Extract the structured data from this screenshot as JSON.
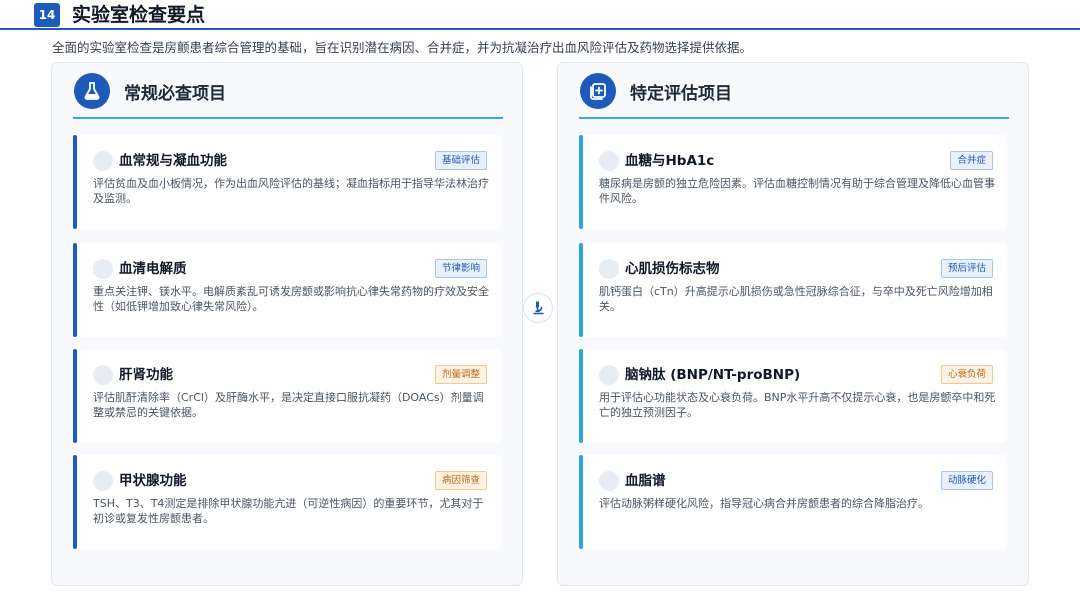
{
  "header": {
    "page_number": "14",
    "title": "实验室检查要点"
  },
  "intro": "全面的实验室检查是房颤患者综合管理的基础，旨在识别潜在病因、合并症，并为抗凝治疗出血风险评估及药物选择提供依据。",
  "icons": {
    "left_panel": "flask-icon",
    "right_panel": "medical-report-icon",
    "center": "microscope-icon",
    "card_marker": "circle-icon"
  },
  "colors": {
    "primary": "#1e5bb8",
    "accent": "#2aa8dc",
    "tag_blue": "#1e5bb8",
    "tag_orange": "#c06a12"
  },
  "left_panel": {
    "title": "常规必查项目",
    "cards": [
      {
        "title": "血常规与凝血功能",
        "tag": "基础评估",
        "tag_color": "blue",
        "desc": "评估贫血及血小板情况，作为出血风险评估的基线；凝血指标用于指导华法林治疗及监测。"
      },
      {
        "title": "血清电解质",
        "tag": "节律影响",
        "tag_color": "blue",
        "desc": "重点关注钾、镁水平。电解质紊乱可诱发房颤或影响抗心律失常药物的疗效及安全性（如低钾增加致心律失常风险）。"
      },
      {
        "title": "肝肾功能",
        "tag": "剂量调整",
        "tag_color": "orange",
        "desc": "评估肌酐清除率（CrCl）及肝酶水平，是决定直接口服抗凝药（DOACs）剂量调整或禁忌的关键依据。"
      },
      {
        "title": "甲状腺功能",
        "tag": "病因筛查",
        "tag_color": "orange",
        "desc": "TSH、T3、T4测定是排除甲状腺功能亢进（可逆性病因）的重要环节，尤其对于初诊或复发性房颤患者。"
      }
    ]
  },
  "right_panel": {
    "title": "特定评估项目",
    "cards": [
      {
        "title": "血糖与HbA1c",
        "tag": "合并症",
        "tag_color": "blue",
        "desc": "糖尿病是房颤的独立危险因素。评估血糖控制情况有助于综合管理及降低心血管事件风险。"
      },
      {
        "title": "心肌损伤标志物",
        "tag": "预后评估",
        "tag_color": "blue",
        "desc": "肌钙蛋白（cTn）升高提示心肌损伤或急性冠脉综合征，与卒中及死亡风险增加相关。"
      },
      {
        "title": "脑钠肽 (BNP/NT-proBNP)",
        "tag": "心衰负荷",
        "tag_color": "orange",
        "desc": "用于评估心功能状态及心衰负荷。BNP水平升高不仅提示心衰，也是房颤卒中和死亡的独立预测因子。"
      },
      {
        "title": "血脂谱",
        "tag": "动脉硬化",
        "tag_color": "blue",
        "desc": "评估动脉粥样硬化风险，指导冠心病合并房颤患者的综合降脂治疗。"
      }
    ]
  }
}
